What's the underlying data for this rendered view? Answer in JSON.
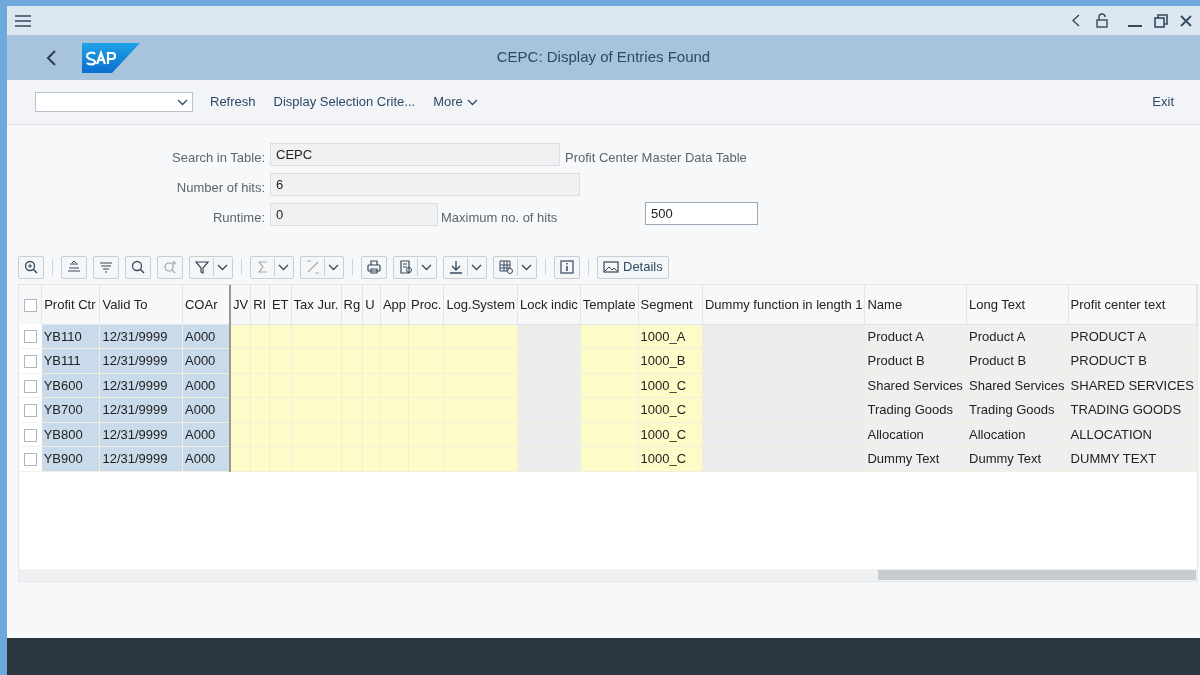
{
  "window": {
    "title": "CEPC: Display of Entries Found"
  },
  "toolbar": {
    "buttons": [
      "Refresh",
      "Display Selection Crite...",
      "More"
    ],
    "exit": "Exit"
  },
  "form": {
    "search_label": "Search in Table:",
    "search_value": "CEPC",
    "table_description": "Profit Center Master Data Table",
    "hits_label": "Number of hits:",
    "hits_value": "6",
    "runtime_label": "Runtime:",
    "runtime_value": "0",
    "max_label": "Maximum no. of hits",
    "max_value": "500"
  },
  "grid_toolbar": {
    "details": "Details"
  },
  "table": {
    "header_selected": false,
    "columns": [
      {
        "label": "Profit Ctr",
        "kind": "key"
      },
      {
        "label": "Valid To",
        "kind": "key"
      },
      {
        "label": "COAr",
        "kind": "key"
      },
      {
        "label": "JV",
        "kind": "input"
      },
      {
        "label": "RI",
        "kind": "input"
      },
      {
        "label": "ET",
        "kind": "input"
      },
      {
        "label": "Tax Jur.",
        "kind": "input"
      },
      {
        "label": "Rg",
        "kind": "input"
      },
      {
        "label": "U",
        "kind": "input"
      },
      {
        "label": "App",
        "kind": "input"
      },
      {
        "label": "Proc.",
        "kind": "input"
      },
      {
        "label": "Log.System",
        "kind": "input"
      },
      {
        "label": "Lock indic",
        "kind": "locked"
      },
      {
        "label": "Template",
        "kind": "input"
      },
      {
        "label": "Segment",
        "kind": "segment"
      },
      {
        "label": "Dummy function in length 1",
        "kind": "locked"
      },
      {
        "label": "Name",
        "kind": "text"
      },
      {
        "label": "Long Text",
        "kind": "text"
      },
      {
        "label": "Profit center text",
        "kind": "text"
      }
    ],
    "rows": [
      {
        "selected": false,
        "cells": [
          "YB110",
          "12/31/9999",
          "A000",
          "1000_A",
          "Product A",
          "Product A",
          "PRODUCT A"
        ]
      },
      {
        "selected": false,
        "cells": [
          "YB111",
          "12/31/9999",
          "A000",
          "1000_B",
          "Product B",
          "Product B",
          "PRODUCT B"
        ]
      },
      {
        "selected": false,
        "cells": [
          "YB600",
          "12/31/9999",
          "A000",
          "1000_C",
          "Shared Services",
          "Shared Services",
          "SHARED SERVICES"
        ]
      },
      {
        "selected": false,
        "cells": [
          "YB700",
          "12/31/9999",
          "A000",
          "1000_C",
          "Trading Goods",
          "Trading Goods",
          "TRADING GOODS"
        ]
      },
      {
        "selected": false,
        "cells": [
          "YB800",
          "12/31/9999",
          "A000",
          "1000_C",
          "Allocation",
          "Allocation",
          "ALLOCATION"
        ]
      },
      {
        "selected": false,
        "cells": [
          "YB900",
          "12/31/9999",
          "A000",
          "1000_C",
          "Dummy Text",
          "Dummy Text",
          "DUMMY TEXT"
        ]
      }
    ]
  }
}
